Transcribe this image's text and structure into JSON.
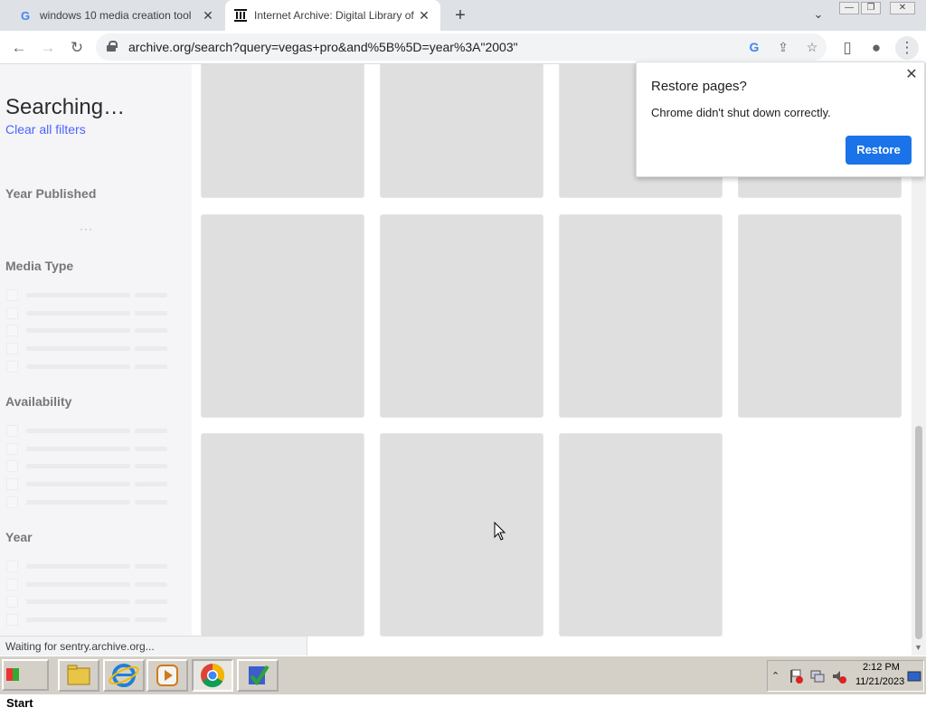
{
  "tabs": [
    {
      "title": "windows 10 media creation tool",
      "favicon": "google-icon",
      "active": false
    },
    {
      "title": "Internet Archive: Digital Library of Free & Borrowable Books",
      "favicon": "internet-archive-icon",
      "active": true
    }
  ],
  "toolbar": {
    "url": "archive.org/search?query=vegas+pro&and%5B%5D=year%3A\"2003\""
  },
  "sidebar": {
    "heading": "Searching…",
    "clear_filters": "Clear all filters",
    "facets": [
      {
        "title": "Year Published"
      },
      {
        "title": "Media Type"
      },
      {
        "title": "Availability"
      },
      {
        "title": "Year"
      }
    ],
    "loading_dots": "···"
  },
  "popup": {
    "title": "Restore pages?",
    "message": "Chrome didn't shut down correctly.",
    "button": "Restore",
    "accent": "#1a73e8"
  },
  "status_bar": {
    "text": "Waiting for sentry.archive.org..."
  },
  "taskbar": {
    "start_label": "Start",
    "apps": [
      "file-explorer-icon",
      "internet-explorer-icon",
      "media-player-icon",
      "chrome-icon",
      "app-checkmark-icon"
    ],
    "clock_time": "2:12 PM",
    "clock_date": "11/21/2023"
  }
}
